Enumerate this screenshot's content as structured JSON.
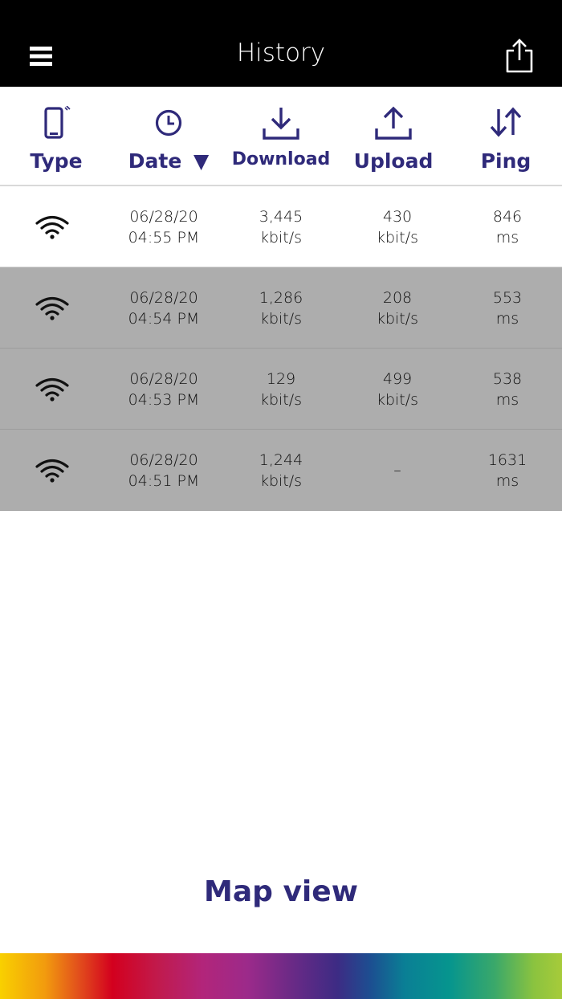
{
  "header": {
    "title": "History",
    "menu_icon": "hamburger-menu-icon",
    "share_icon": "share-icon"
  },
  "columns": {
    "type": {
      "label": "Type",
      "icon": "phone-icon"
    },
    "date": {
      "label": "Date",
      "icon": "clock-icon",
      "sort_indicator": "▼"
    },
    "download": {
      "label": "Download",
      "icon": "download-icon"
    },
    "upload": {
      "label": "Upload",
      "icon": "upload-icon"
    },
    "ping": {
      "label": "Ping",
      "icon": "ping-arrows-icon"
    }
  },
  "rows": [
    {
      "type_icon": "wifi-icon",
      "date": "06/28/20",
      "time": "04:55 PM",
      "download": "3,445",
      "download_unit": "kbit/s",
      "upload": "430",
      "upload_unit": "kbit/s",
      "ping": "846",
      "ping_unit": "ms",
      "highlighted": false
    },
    {
      "type_icon": "wifi-icon",
      "date": "06/28/20",
      "time": "04:54 PM",
      "download": "1,286",
      "download_unit": "kbit/s",
      "upload": "208",
      "upload_unit": "kbit/s",
      "ping": "553",
      "ping_unit": "ms",
      "highlighted": true
    },
    {
      "type_icon": "wifi-icon",
      "date": "06/28/20",
      "time": "04:53 PM",
      "download": "129",
      "download_unit": "kbit/s",
      "upload": "499",
      "upload_unit": "kbit/s",
      "ping": "538",
      "ping_unit": "ms",
      "highlighted": true
    },
    {
      "type_icon": "wifi-icon",
      "date": "06/28/20",
      "time": "04:51 PM",
      "download": "1,244",
      "download_unit": "kbit/s",
      "upload": "–",
      "upload_unit": "",
      "ping": "1631",
      "ping_unit": "ms",
      "highlighted": true
    }
  ],
  "footer": {
    "map_view_label": "Map view"
  },
  "colors": {
    "accent": "#2f2a7a",
    "header_bg": "#000000",
    "row_highlight": "#adadad"
  }
}
